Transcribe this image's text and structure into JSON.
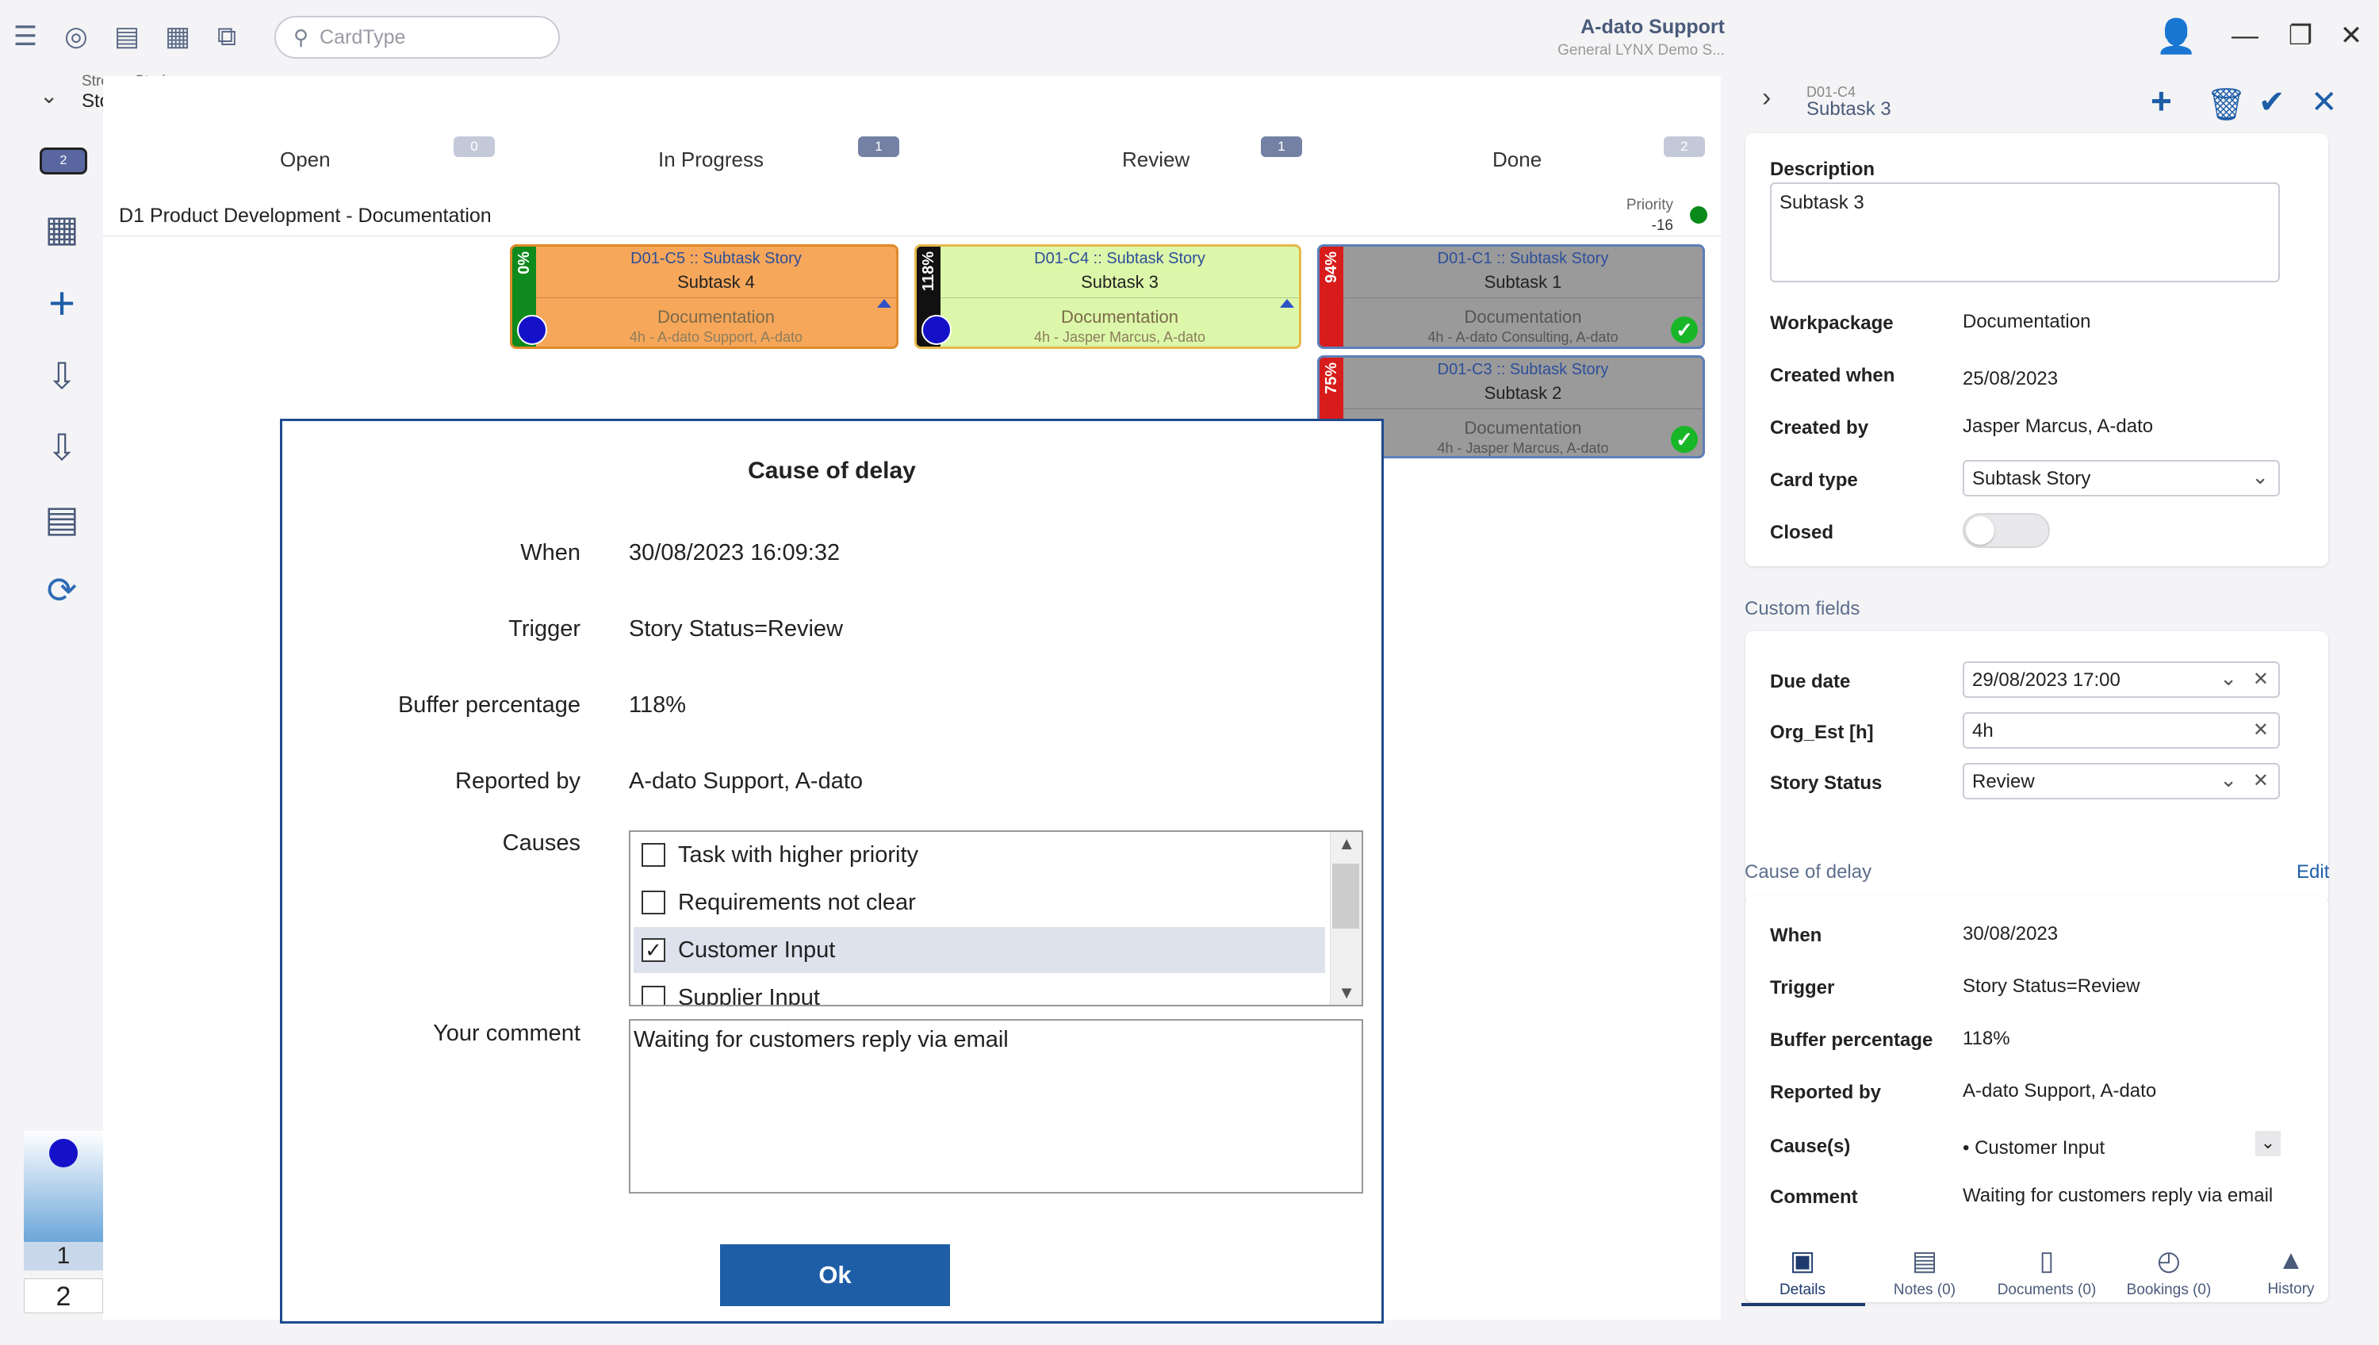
{
  "search": {
    "placeholder": "CardType"
  },
  "user": {
    "name": "A-dato Support",
    "org": "General LYNX Demo S..."
  },
  "breadcrumb": {
    "parent": "Stream Stories",
    "current": "Stories"
  },
  "columns": [
    {
      "label": "Open",
      "count": "0"
    },
    {
      "label": "In Progress",
      "count": "1"
    },
    {
      "label": "Review",
      "count": "1"
    },
    {
      "label": "Done",
      "count": "2"
    }
  ],
  "view_badge": "2",
  "swimlane": {
    "title": "D1 Product Development - Documentation",
    "priority_label": "Priority",
    "priority_value": "-16"
  },
  "cards": [
    {
      "id": "D01-C5 :: Subtask Story",
      "title": "Subtask 4",
      "pct": "0%",
      "workpackage": "Documentation",
      "who": "4h - A-dato Support, A-dato"
    },
    {
      "id": "D01-C4 :: Subtask Story",
      "title": "Subtask 3",
      "pct": "118%",
      "workpackage": "Documentation",
      "who": "4h - Jasper Marcus, A-dato"
    },
    {
      "id": "D01-C1 :: Subtask Story",
      "title": "Subtask 1",
      "pct": "94%",
      "workpackage": "Documentation",
      "who": "4h - A-dato Consulting, A-dato"
    },
    {
      "id": "D01-C3 :: Subtask Story",
      "title": "Subtask 2",
      "pct": "75%",
      "workpackage": "Documentation",
      "who": "4h - Jasper Marcus, A-dato"
    }
  ],
  "pager": {
    "p1": "1",
    "p2": "2"
  },
  "dialog": {
    "title": "Cause of delay",
    "when_label": "When",
    "when": "30/08/2023 16:09:32",
    "trigger_label": "Trigger",
    "trigger": "Story Status=Review",
    "buffer_label": "Buffer percentage",
    "buffer": "118%",
    "reported_label": "Reported by",
    "reported": "A-dato Support, A-dato",
    "causes_label": "Causes",
    "causes": [
      {
        "label": "Task with higher priority",
        "checked": false
      },
      {
        "label": "Requirements not clear",
        "checked": false
      },
      {
        "label": "Customer Input",
        "checked": true
      },
      {
        "label": "Supplier Input",
        "checked": false
      }
    ],
    "comment_label": "Your comment",
    "comment": "Waiting for customers reply via email",
    "ok": "Ok"
  },
  "panel": {
    "id": "D01-C4",
    "title": "Subtask 3",
    "description_label": "Description",
    "description": "Subtask 3",
    "workpackage_label": "Workpackage",
    "workpackage": "Documentation",
    "created_when_label": "Created when",
    "created_when": "25/08/2023",
    "created_by_label": "Created by",
    "created_by": "Jasper Marcus, A-dato",
    "card_type_label": "Card type",
    "card_type": "Subtask Story",
    "closed_label": "Closed",
    "custom_fields_title": "Custom fields",
    "due_label": "Due date",
    "due": "29/08/2023 17:00",
    "org_est_label": "Org_Est [h]",
    "org_est": "4h",
    "status_label": "Story Status",
    "status": "Review",
    "cod_title": "Cause of delay",
    "cod_edit": "Edit",
    "cod_when_label": "When",
    "cod_when": "30/08/2023",
    "cod_trigger_label": "Trigger",
    "cod_trigger": "Story Status=Review",
    "cod_buffer_label": "Buffer percentage",
    "cod_buffer": "118%",
    "cod_reported_label": "Reported by",
    "cod_reported": "A-dato Support, A-dato",
    "cod_causes_label": "Cause(s)",
    "cod_causes": "Customer Input",
    "cod_comment_label": "Comment",
    "cod_comment": "Waiting for customers reply via email"
  },
  "tabs": [
    {
      "label": "Details",
      "icon": "details-icon"
    },
    {
      "label": "Notes (0)",
      "icon": "notes-icon"
    },
    {
      "label": "Documents (0)",
      "icon": "documents-icon"
    },
    {
      "label": "Bookings (0)",
      "icon": "bookings-icon"
    },
    {
      "label": "History",
      "icon": "history-icon"
    }
  ],
  "colors": {
    "accent": "#1e5ea7",
    "card_orange": "#f7a75a",
    "card_green": "#dcf7a9",
    "card_gray": "#9a9a9a",
    "ball": "#1411c9"
  }
}
